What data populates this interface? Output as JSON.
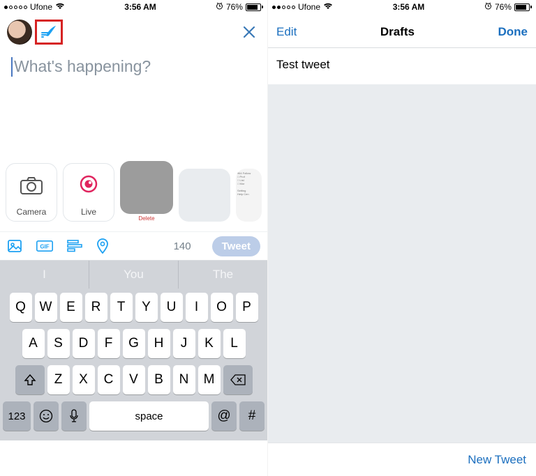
{
  "status": {
    "carrier": "Ufone",
    "time": "3:56 AM",
    "battery_pct": "76%",
    "signal_filled": 1,
    "signal_total": 5,
    "signal_filled_right": 2
  },
  "compose": {
    "placeholder": "What's happening?",
    "close_label": "✕",
    "char_remaining": "140",
    "tweet_button": "Tweet",
    "media_tiles": {
      "camera": "Camera",
      "live": "Live",
      "delete_label": "Delete"
    },
    "toolbar_icons": {
      "photo": "photo-icon",
      "gif": "GIF",
      "poll": "poll-icon",
      "location": "location-icon"
    }
  },
  "keyboard": {
    "suggestions": [
      "I",
      "You",
      "The"
    ],
    "row1": [
      "Q",
      "W",
      "E",
      "R",
      "T",
      "Y",
      "U",
      "I",
      "O",
      "P"
    ],
    "row2": [
      "A",
      "S",
      "D",
      "F",
      "G",
      "H",
      "J",
      "K",
      "L"
    ],
    "row3": [
      "Z",
      "X",
      "C",
      "V",
      "B",
      "N",
      "M"
    ],
    "shift": "⇧",
    "backspace": "⌫",
    "number_key": "123",
    "emoji": "☺",
    "mic": "🎤",
    "space": "space",
    "at": "@",
    "hash": "#"
  },
  "drafts": {
    "edit": "Edit",
    "title": "Drafts",
    "done": "Done",
    "items": [
      {
        "text": "Test tweet"
      }
    ],
    "new_tweet": "New Tweet"
  }
}
